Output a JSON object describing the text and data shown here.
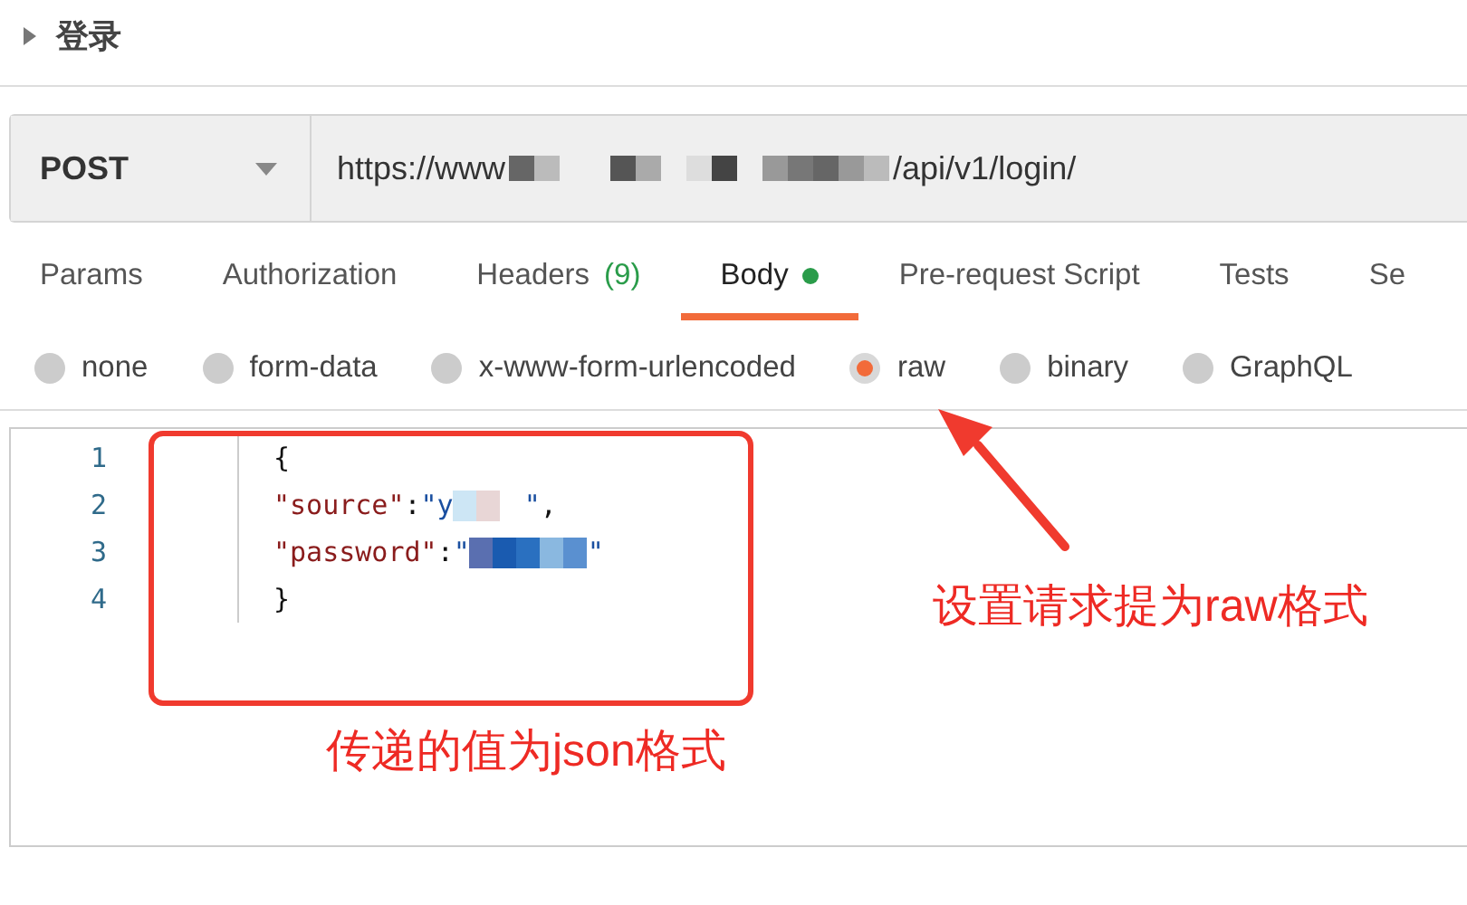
{
  "request": {
    "name": "登录",
    "expanded": false
  },
  "url_bar": {
    "method": "POST",
    "url_start": "https://www",
    "url_redacted": true,
    "url_end": "/api/v1/login/"
  },
  "tabs": [
    {
      "label": "Params",
      "selected": false
    },
    {
      "label": "Authorization",
      "selected": false
    },
    {
      "label": "Headers",
      "count": "(9)",
      "selected": false
    },
    {
      "label": "Body",
      "dot": true,
      "selected": true
    },
    {
      "label": "Pre-request Script",
      "selected": false
    },
    {
      "label": "Tests",
      "selected": false
    },
    {
      "label": "Se",
      "selected": false
    }
  ],
  "body_types": [
    {
      "label": "none",
      "selected": false
    },
    {
      "label": "form-data",
      "selected": false
    },
    {
      "label": "x-www-form-urlencoded",
      "selected": false
    },
    {
      "label": "raw",
      "selected": true
    },
    {
      "label": "binary",
      "selected": false
    },
    {
      "label": "GraphQL",
      "selected": false
    }
  ],
  "editor": {
    "lines": [
      {
        "number": "1",
        "segments": [
          {
            "kind": "punct",
            "text": "{"
          }
        ]
      },
      {
        "number": "2",
        "segments": [
          {
            "kind": "key",
            "text": "\"source\""
          },
          {
            "kind": "punct",
            "text": ":"
          },
          {
            "kind": "string",
            "text": "\"y"
          },
          {
            "kind": "redacted"
          },
          {
            "kind": "string",
            "text": "\""
          },
          {
            "kind": "punct",
            "text": ","
          }
        ]
      },
      {
        "number": "3",
        "segments": [
          {
            "kind": "key",
            "text": "\"password\""
          },
          {
            "kind": "punct",
            "text": ":"
          },
          {
            "kind": "string",
            "text": "\""
          },
          {
            "kind": "redacted"
          },
          {
            "kind": "string",
            "text": "\""
          }
        ]
      },
      {
        "number": "4",
        "segments": [
          {
            "kind": "punct",
            "text": "}"
          }
        ]
      }
    ]
  },
  "annotations": {
    "body_note": "传递的值为json格式",
    "raw_note": "设置请求提为raw格式"
  }
}
